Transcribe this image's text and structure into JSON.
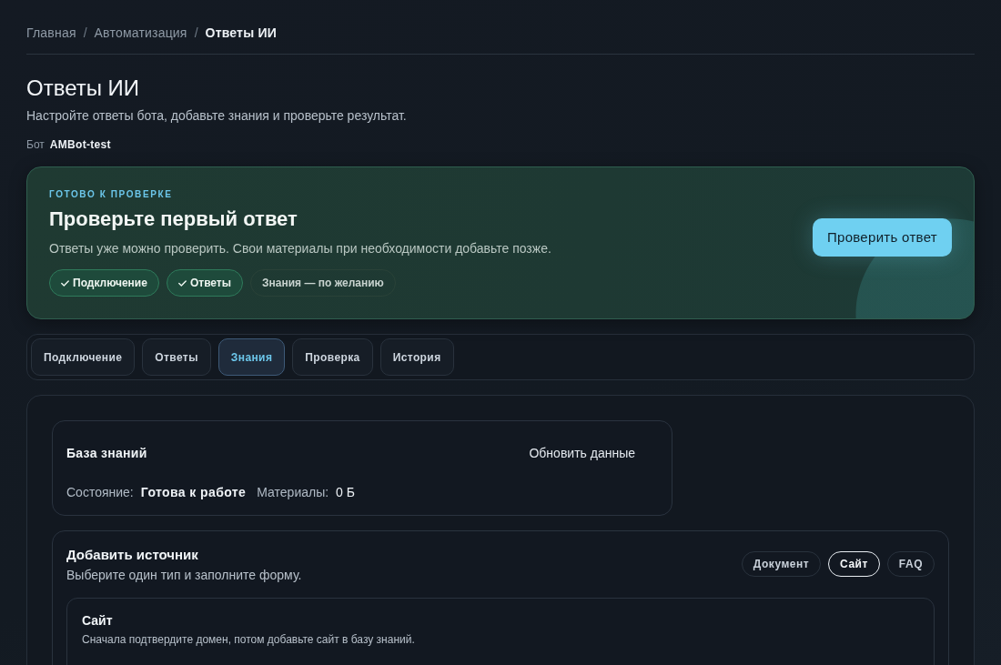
{
  "breadcrumbs": [
    {
      "label": "Главная",
      "current": false,
      "separator": "/"
    },
    {
      "label": "Автоматизация",
      "current": false,
      "separator": "/"
    },
    {
      "label": "Ответы ИИ",
      "current": true
    }
  ],
  "header": {
    "title": "Ответы ИИ",
    "subtitle": "Настройте ответы бота, добавьте знания и проверьте результат.",
    "bot_label": "Бот",
    "bot_name": "AMBot-test"
  },
  "hero": {
    "eyebrow": "ГОТОВО К ПРОВЕРКЕ",
    "title": "Проверьте первый ответ",
    "text": "Ответы уже можно проверить. Свои материалы при необходимости добавьте позже.",
    "steps": [
      {
        "label": "Подключение",
        "done": true
      },
      {
        "label": "Ответы",
        "done": true
      },
      {
        "label": "Знания — по желанию",
        "done": false
      }
    ],
    "action": "Проверить ответ"
  },
  "tabs": [
    {
      "label": "Подключение",
      "selected": false
    },
    {
      "label": "Ответы",
      "selected": false
    },
    {
      "label": "Знания",
      "selected": true
    },
    {
      "label": "Проверка",
      "selected": false
    },
    {
      "label": "История",
      "selected": false
    }
  ],
  "knowledge_base": {
    "title": "База знаний",
    "refresh": "Обновить данные",
    "stats": [
      {
        "kind": "status",
        "label": "Состояние:",
        "value": "Готова к работе"
      },
      {
        "kind": "metric",
        "label": "Материалы:",
        "value": "0 Б"
      }
    ]
  },
  "add_source": {
    "title": "Добавить источник",
    "subtitle": "Выберите один тип и заполните форму.",
    "types": [
      {
        "label": "Документ",
        "selected": false
      },
      {
        "label": "Сайт",
        "selected": true
      },
      {
        "label": "FAQ",
        "selected": false
      }
    ],
    "form": {
      "title": "Сайт",
      "hint": "Сначала подтвердите домен, потом добавьте сайт в базу знаний."
    }
  }
}
